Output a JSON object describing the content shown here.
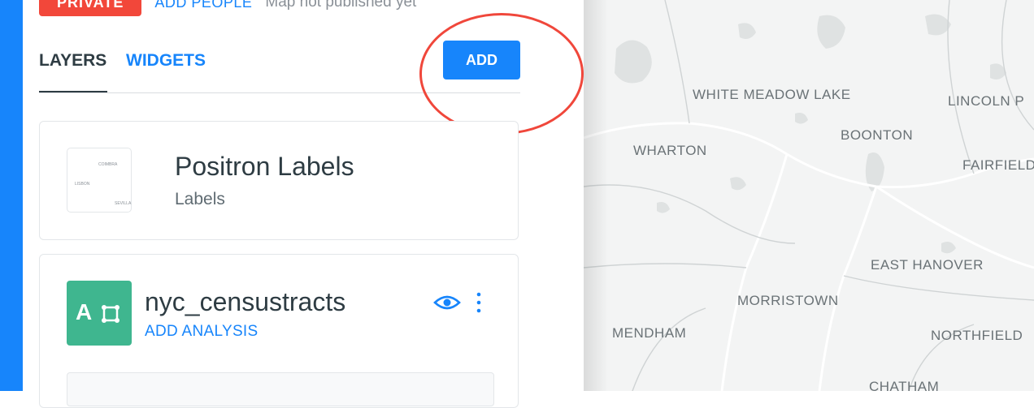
{
  "topbar": {
    "privacy_label": "PRIVATE",
    "add_people_label": "ADD PEOPLE",
    "publish_status": "Map not published yet"
  },
  "tabs": [
    {
      "label": "LAYERS",
      "active": true
    },
    {
      "label": "WIDGETS",
      "active": false
    }
  ],
  "add_button_label": "ADD",
  "layers": [
    {
      "title": "Positron Labels",
      "subtitle": "Labels",
      "thumbnail_labels": [
        "COIMBRA",
        "LISBON",
        "SEVILLA"
      ]
    },
    {
      "title": "nyc_censustracts",
      "source_letter": "A",
      "action_label": "ADD ANALYSIS",
      "icons": [
        "eye-icon",
        "more-vertical-icon"
      ]
    }
  ],
  "map": {
    "place_labels": [
      "WHITE MEADOW LAKE",
      "LINCOLN P",
      "BOONTON",
      "WHARTON",
      "FAIRFIELD",
      "EAST HANOVER",
      "MORRISTOWN",
      "MENDHAM",
      "NORTHFIELD",
      "CHATHAM"
    ]
  },
  "colors": {
    "accent": "#1785fb",
    "private_badge": "#f2473a",
    "callout_ring": "#f0473b",
    "source_icon": "#3fb68f",
    "map_background": "#f3f4f4"
  }
}
